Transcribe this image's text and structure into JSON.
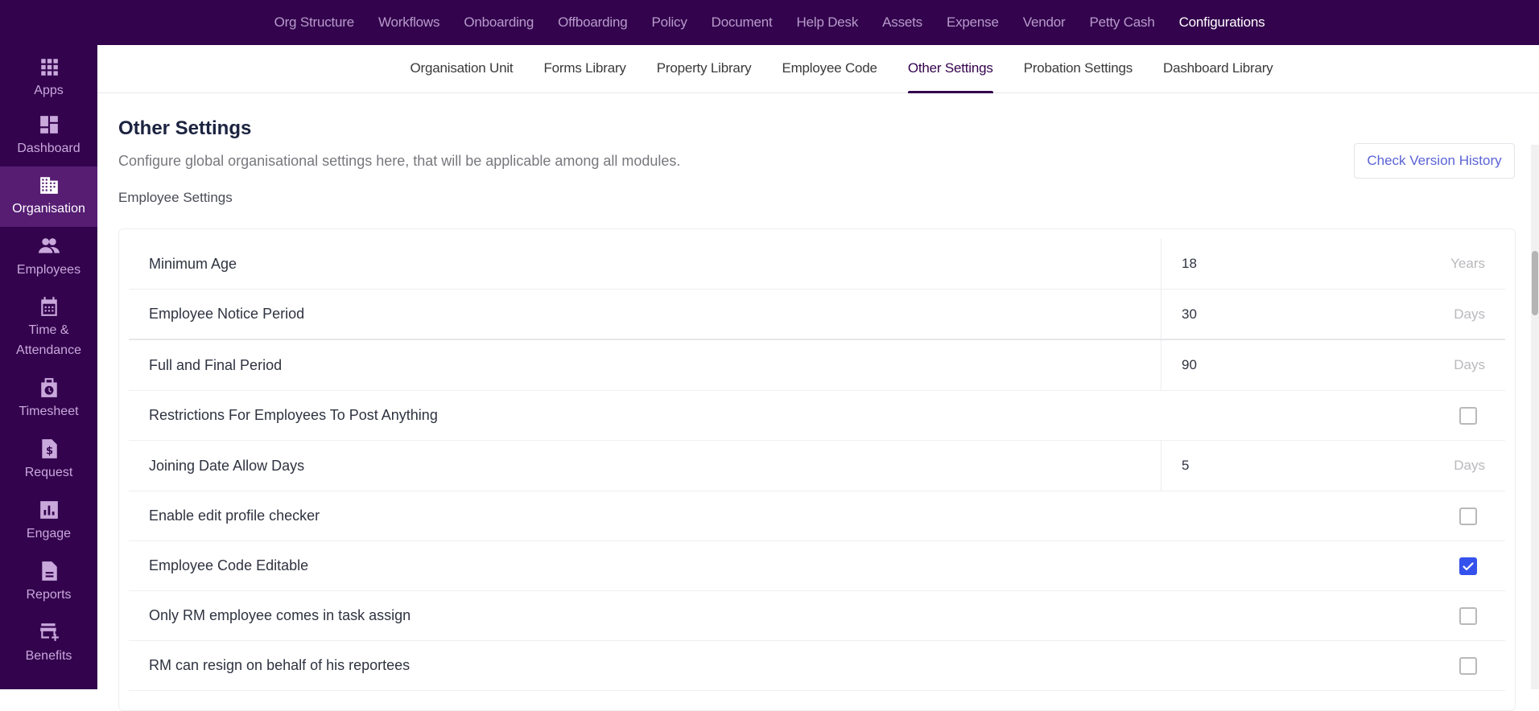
{
  "topnav": {
    "items": [
      "Org Structure",
      "Workflows",
      "Onboarding",
      "Offboarding",
      "Policy",
      "Document",
      "Help Desk",
      "Assets",
      "Expense",
      "Vendor",
      "Petty Cash",
      "Configurations"
    ],
    "active": "Configurations"
  },
  "sidebar": {
    "items": [
      {
        "label": "Apps",
        "icon": "apps-grid-icon"
      },
      {
        "label": "Dashboard",
        "icon": "dashboard-icon"
      },
      {
        "label": "Organisation",
        "icon": "building-icon",
        "active": true
      },
      {
        "label": "Employees",
        "icon": "people-icon"
      },
      {
        "label": "Time & Attendance",
        "icon": "calendar-icon"
      },
      {
        "label": "Timesheet",
        "icon": "timesheet-clock-icon"
      },
      {
        "label": "Request",
        "icon": "dollar-document-icon"
      },
      {
        "label": "Engage",
        "icon": "bar-chart-icon"
      },
      {
        "label": "Reports",
        "icon": "report-document-icon"
      },
      {
        "label": "Benefits",
        "icon": "store-add-icon"
      }
    ]
  },
  "subnav": {
    "tabs": [
      "Organisation Unit",
      "Forms Library",
      "Property Library",
      "Employee Code",
      "Other Settings",
      "Probation Settings",
      "Dashboard Library"
    ],
    "active": "Other Settings"
  },
  "main": {
    "title": "Other Settings",
    "description": "Configure global organisational settings here, that will be applicable among all modules.",
    "section": "Employee Settings",
    "version_button": "Check Version History",
    "settings": [
      {
        "label": "Minimum Age",
        "type": "number",
        "value": "18",
        "unit": "Years"
      },
      {
        "label": "Employee Notice Period",
        "type": "number",
        "value": "30",
        "unit": "Days"
      },
      {
        "label": "Full and Final Period",
        "type": "number",
        "value": "90",
        "unit": "Days"
      },
      {
        "label": "Restrictions For Employees To Post Anything",
        "type": "checkbox",
        "checked": false
      },
      {
        "label": "Joining Date Allow Days",
        "type": "number",
        "value": "5",
        "unit": "Days"
      },
      {
        "label": "Enable edit profile checker",
        "type": "checkbox",
        "checked": false
      },
      {
        "label": "Employee Code Editable",
        "type": "checkbox",
        "checked": true
      },
      {
        "label": "Only RM employee comes in task assign",
        "type": "checkbox",
        "checked": false
      },
      {
        "label": "RM can resign on behalf of his reportees",
        "type": "checkbox",
        "checked": false
      }
    ]
  },
  "colors": {
    "brand": "#33034d",
    "sidebar_active": "#561d73",
    "checkbox_checked": "#3452eb",
    "link": "#5a63d6"
  }
}
